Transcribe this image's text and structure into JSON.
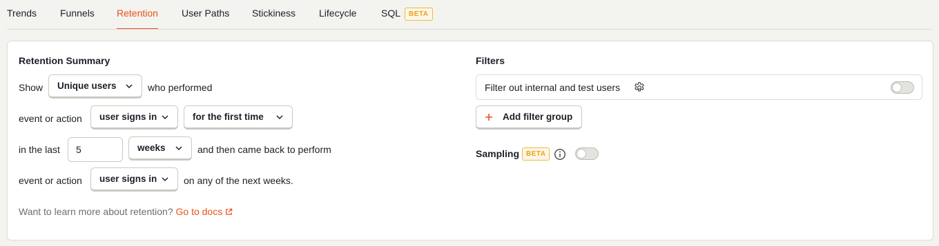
{
  "tabs": [
    {
      "label": "Trends"
    },
    {
      "label": "Funnels"
    },
    {
      "label": "Retention",
      "active": true
    },
    {
      "label": "User Paths"
    },
    {
      "label": "Stickiness"
    },
    {
      "label": "Lifecycle"
    },
    {
      "label": "SQL",
      "badge": "BETA"
    }
  ],
  "summary": {
    "title": "Retention Summary",
    "row1": {
      "prefix": "Show",
      "select": "Unique users",
      "suffix": "who performed"
    },
    "row2": {
      "prefix": "event or action",
      "event": "user signs in",
      "occurrence": "for the first time"
    },
    "row3": {
      "prefix": "in the last",
      "period_value": "5",
      "period_unit": "weeks",
      "suffix": "and then came back to perform"
    },
    "row4": {
      "prefix": "event or action",
      "event": "user signs in",
      "suffix": "on any of the next weeks."
    },
    "docs_text": "Want to learn more about retention?",
    "docs_link": "Go to docs"
  },
  "filters": {
    "title": "Filters",
    "internal_label": "Filter out internal and test users",
    "internal_enabled": false,
    "add_group_label": "Add filter group",
    "sampling_label": "Sampling",
    "sampling_badge": "BETA",
    "sampling_enabled": false
  },
  "colors": {
    "accent": "#e8521b",
    "beta": "#f0a01a"
  }
}
